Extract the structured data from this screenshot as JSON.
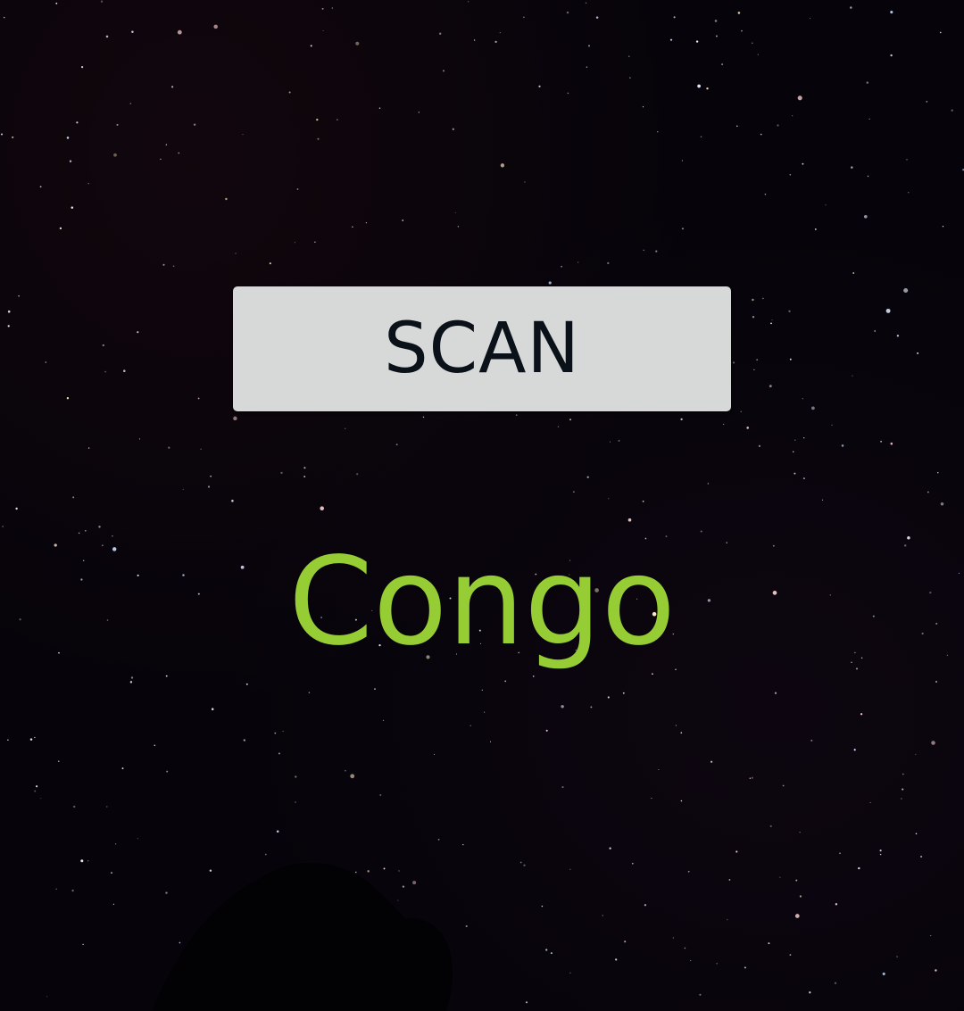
{
  "scan_button": {
    "label": "SCAN"
  },
  "result": {
    "text": "Congo"
  },
  "colors": {
    "background": "#06040a",
    "button_background": "#d7d8d8",
    "button_text": "#0b1118",
    "result_text": "#96cc34"
  }
}
